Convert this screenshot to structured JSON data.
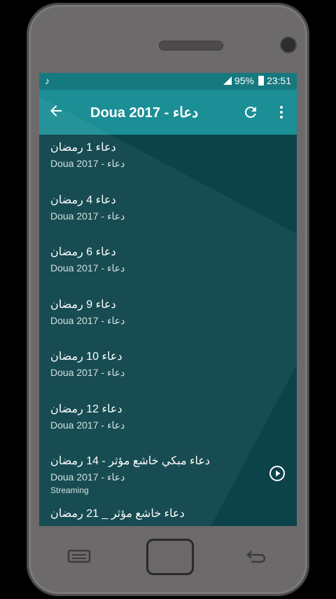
{
  "status_bar": {
    "battery": "95%",
    "time": "23:51",
    "music_icon": "music-note-icon"
  },
  "app_bar": {
    "title": "Doua 2017 - دعاء",
    "back_icon": "arrow-back-icon",
    "refresh_icon": "refresh-icon",
    "more_icon": "more-vert-icon"
  },
  "tracks": [
    {
      "title": "دعاء 1 رمضان",
      "subtitle": "Doua 2017 - دعاء"
    },
    {
      "title": "دعاء 4 رمضان",
      "subtitle": "Doua 2017 - دعاء"
    },
    {
      "title": "دعاء 6 رمضان",
      "subtitle": "Doua 2017 - دعاء"
    },
    {
      "title": "دعاء 9 رمضان",
      "subtitle": "Doua 2017 - دعاء"
    },
    {
      "title": "دعاء 10 رمضان",
      "subtitle": "Doua 2017 - دعاء"
    },
    {
      "title": "دعاء 12 رمضان",
      "subtitle": "Doua 2017 - دعاء"
    },
    {
      "title": "دعاء مبكي خاشع مؤثر - 14 رمضان",
      "subtitle": "Doua 2017 - دعاء",
      "extra": "Streaming"
    },
    {
      "title": "دعاء خاشع مؤثر _ 21 رمضان",
      "subtitle": ""
    }
  ],
  "colors": {
    "status_bar": "#16797f",
    "app_bar": "#1b8e96",
    "list_background": "#0b4349"
  }
}
